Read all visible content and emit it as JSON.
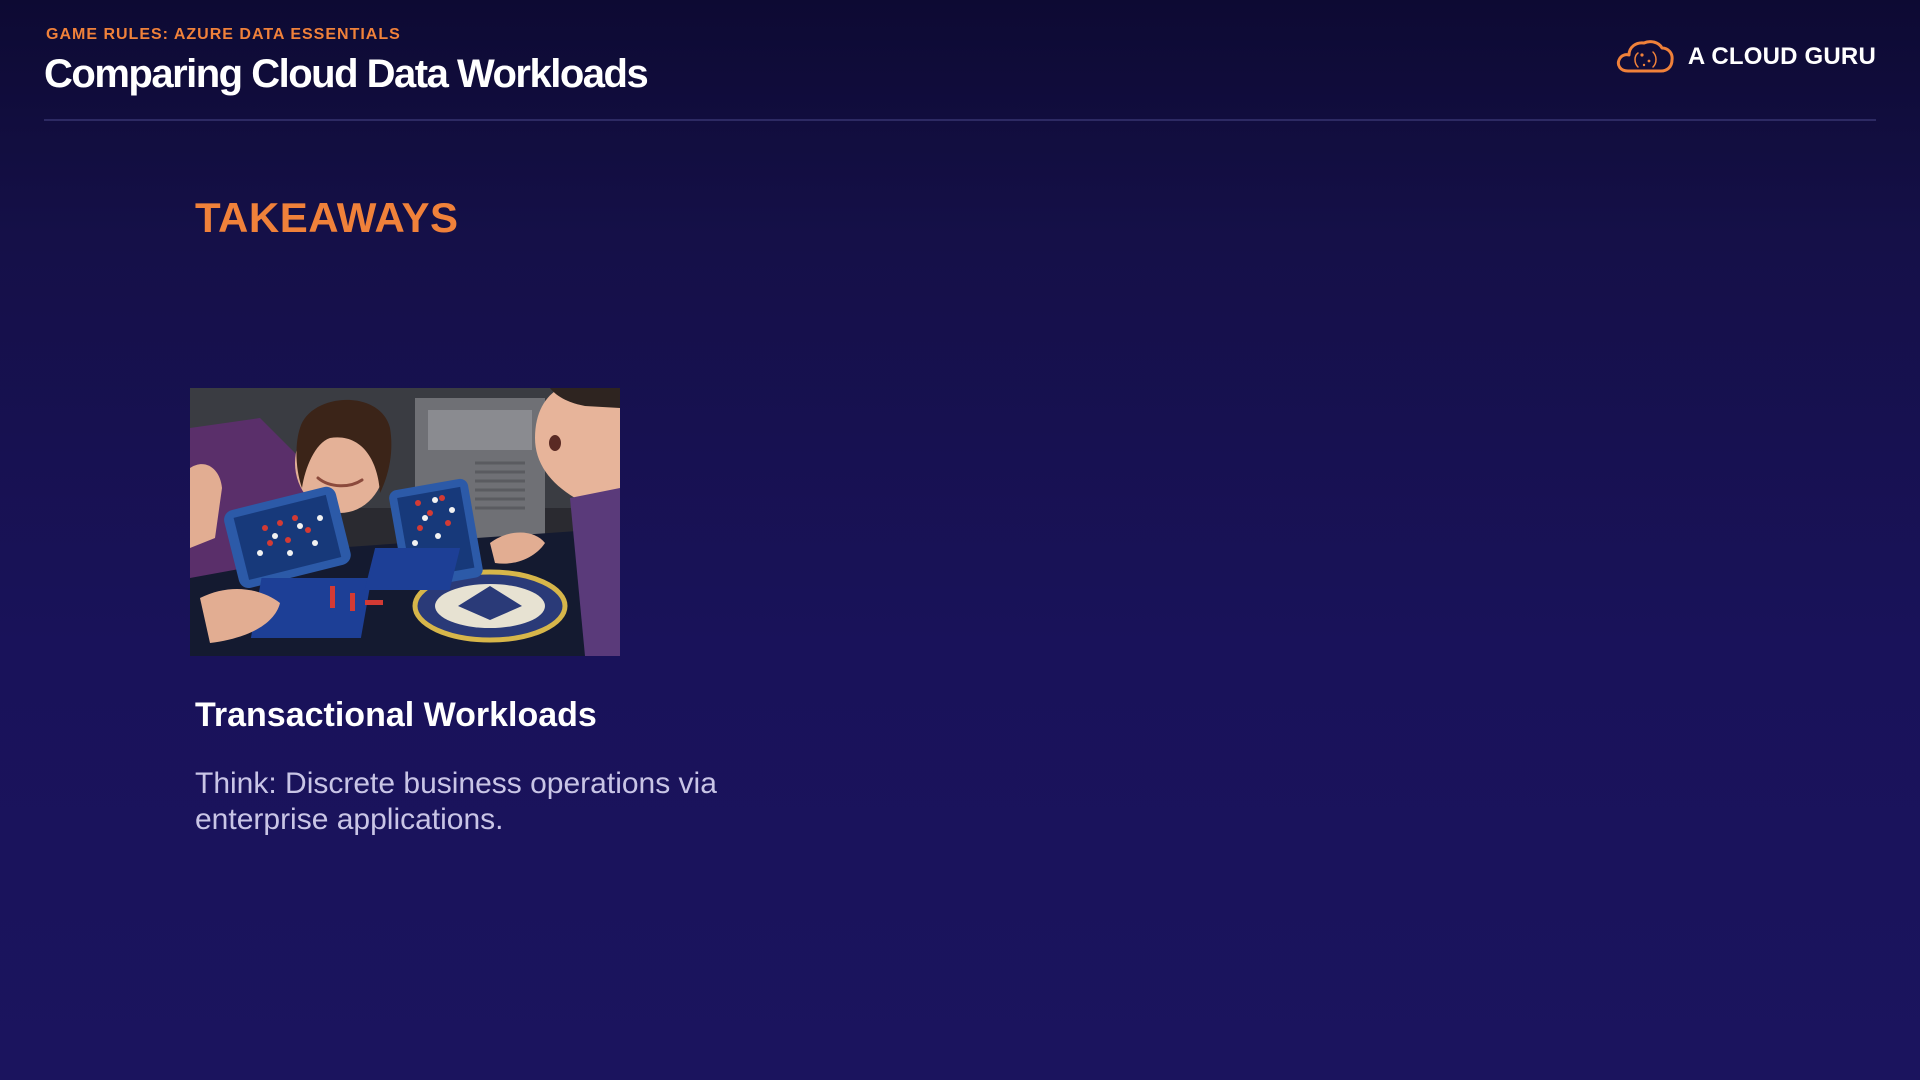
{
  "header": {
    "eyebrow": "GAME RULES: AZURE DATA ESSENTIALS",
    "title": "Comparing Cloud Data Workloads"
  },
  "brand": {
    "name": "A CLOUD GURU",
    "logo_icon": "cloud-logo-icon"
  },
  "section": {
    "heading": "TAKEAWAYS"
  },
  "card": {
    "image_alt": "Two people playing a Battleship board game",
    "title": "Transactional Workloads",
    "body": "Think: Discrete business operations via enterprise applications."
  },
  "colors": {
    "background": "#19125a",
    "accent": "#f0813a",
    "text": "#ffffff",
    "muted_text": "#c9c5e6"
  }
}
